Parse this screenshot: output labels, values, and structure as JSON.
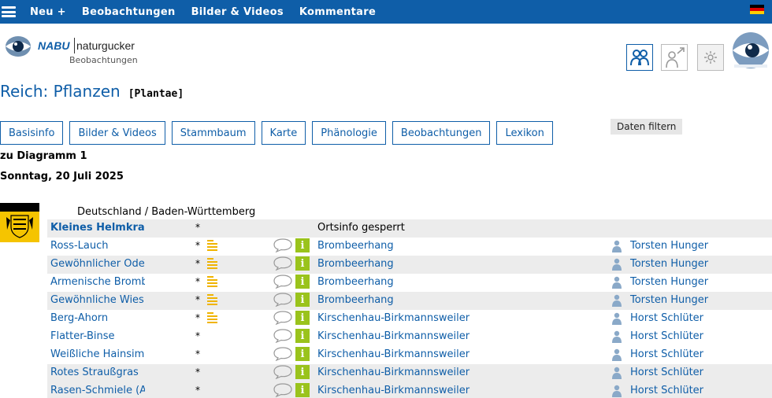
{
  "topbar": {
    "menu_icon": "hamburger-icon",
    "nav": [
      "Neu +",
      "Beobachtungen",
      "Bilder & Videos",
      "Kommentare"
    ],
    "flag_colors": [
      "#000000",
      "#dd0000",
      "#ffce00"
    ]
  },
  "logo": {
    "nabu": "NABU",
    "naturgucker": "naturgucker",
    "subtitle": "Beobachtungen"
  },
  "header_icons": [
    "people-icon",
    "person-arrow-icon",
    "settings-icon"
  ],
  "title": {
    "main": "Reich: Pflanzen",
    "scientific": "[Plantae]"
  },
  "tabs": [
    "Basisinfo",
    "Bilder & Videos",
    "Stammbaum",
    "Karte",
    "Phänologie",
    "Beobachtungen",
    "Lexikon"
  ],
  "filter_label": "Daten filtern",
  "diagram_link": "zu Diagramm 1",
  "date": "Sonntag, 20 Juli 2025",
  "region": "Deutschland / Baden-Württemberg",
  "accent_color": "#0f5ea8",
  "rows": [
    {
      "name": "Kleines Helmkra",
      "star": "*",
      "place": "Ortsinfo gesperrt",
      "user": ""
    },
    {
      "name": "Ross-Lauch",
      "star": "*",
      "place": "Brombeerhang",
      "user": "Torsten Hunger"
    },
    {
      "name": "Gewöhnlicher Ode",
      "star": "*",
      "place": "Brombeerhang",
      "user": "Torsten Hunger"
    },
    {
      "name": "Armenische Brombe",
      "star": "*",
      "place": "Brombeerhang",
      "user": "Torsten Hunger"
    },
    {
      "name": "Gewöhnliche Wies",
      "star": "*",
      "place": "Brombeerhang",
      "user": "Torsten Hunger"
    },
    {
      "name": "Berg-Ahorn",
      "star": "*",
      "place": "Kirschenhau-Birkmannsweiler",
      "user": "Horst Schlüter"
    },
    {
      "name": "Flatter-Binse",
      "star": "*",
      "place": "Kirschenhau-Birkmannsweiler",
      "user": "Horst Schlüter"
    },
    {
      "name": "Weißliche Hainsim",
      "star": "*",
      "place": "Kirschenhau-Birkmannsweiler",
      "user": "Horst Schlüter"
    },
    {
      "name": "Rotes Straußgras",
      "star": "*",
      "place": "Kirschenhau-Birkmannsweiler",
      "user": "Horst Schlüter"
    },
    {
      "name": "Rasen-Schmiele (A",
      "star": "*",
      "place": "Kirschenhau-Birkmannsweiler",
      "user": "Horst Schlüter"
    }
  ]
}
